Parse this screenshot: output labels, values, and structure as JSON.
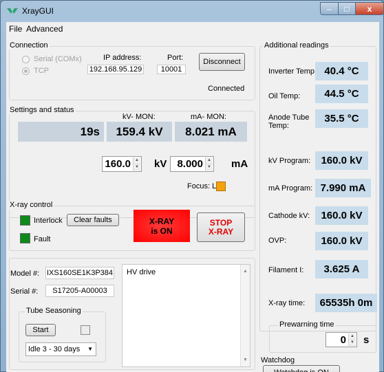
{
  "window": {
    "title": "XrayGUI",
    "minimize": "–",
    "maximize": "□",
    "close": "x"
  },
  "menu": {
    "file": "File",
    "advanced": "Advanced"
  },
  "connection": {
    "title": "Connection",
    "serial_label": "Serial (COMx)",
    "tcp_label": "TCP",
    "ip_label": "IP address:",
    "ip_value": "192.168.95.129",
    "port_label": "Port:",
    "port_value": "10001",
    "disconnect_label": "Disconnect",
    "status": "Connected"
  },
  "settings": {
    "title": "Settings and status",
    "kv_mon_label": "kV- MON:",
    "ma_mon_label": "mA- MON:",
    "time_value": "19s",
    "kv_mon_value": "159.4 kV",
    "ma_mon_value": "8.021 mA",
    "kv_set": "160.0",
    "kv_unit": "kV",
    "ma_set": "8.000",
    "ma_unit": "mA",
    "focus_label": "Focus: L",
    "focus_color": "#f5a20a"
  },
  "xray_control": {
    "title": "X-ray control",
    "interlock_label": "Interlock",
    "fault_label": "Fault",
    "clear_faults_label": "Clear faults",
    "xray_on_line1": "X-RAY",
    "xray_on_line2": "is ON",
    "stop_line1": "STOP",
    "stop_line2": "X-RAY",
    "led_color": "#0d8a1a",
    "xray_on_color": "#ff1a1a"
  },
  "info": {
    "model_label": "Model #:",
    "model_value": "IXS160SE1K3P384",
    "serial_label": "Serial #:",
    "serial_value": "S17205-A00003",
    "notes": "HV drive"
  },
  "seasoning": {
    "title": "Tube Seasoning",
    "start_label": "Start",
    "mode_selected": "Idle 3 - 30 days"
  },
  "additional": {
    "title": "Additional readings",
    "inverter_temp_label": "Inverter Temp:",
    "inverter_temp_value": "40.4 °C",
    "oil_temp_label": "Oil Temp:",
    "oil_temp_value": "44.5 °C",
    "anode_temp_label_1": "Anode Tube",
    "anode_temp_label_2": "Temp:",
    "anode_temp_value": "35.5 °C",
    "kv_program_label": "kV Program:",
    "kv_program_value": "160.0 kV",
    "ma_program_label": "mA Program:",
    "ma_program_value": "7.990 mA",
    "cathode_kv_label": "Cathode kV:",
    "cathode_kv_value": "160.0 kV",
    "ovp_label": "OVP:",
    "ovp_value": "160.0 kV",
    "filament_label": "Filament I:",
    "filament_value": "3.625 A",
    "xray_time_label": "X-ray time:",
    "xray_time_value": "65535h 0m"
  },
  "prewarming": {
    "title": "Prewarning time",
    "value": "0",
    "unit": "s"
  },
  "watchdog": {
    "title": "Watchdog",
    "button_label": "Watchdog is ON"
  }
}
